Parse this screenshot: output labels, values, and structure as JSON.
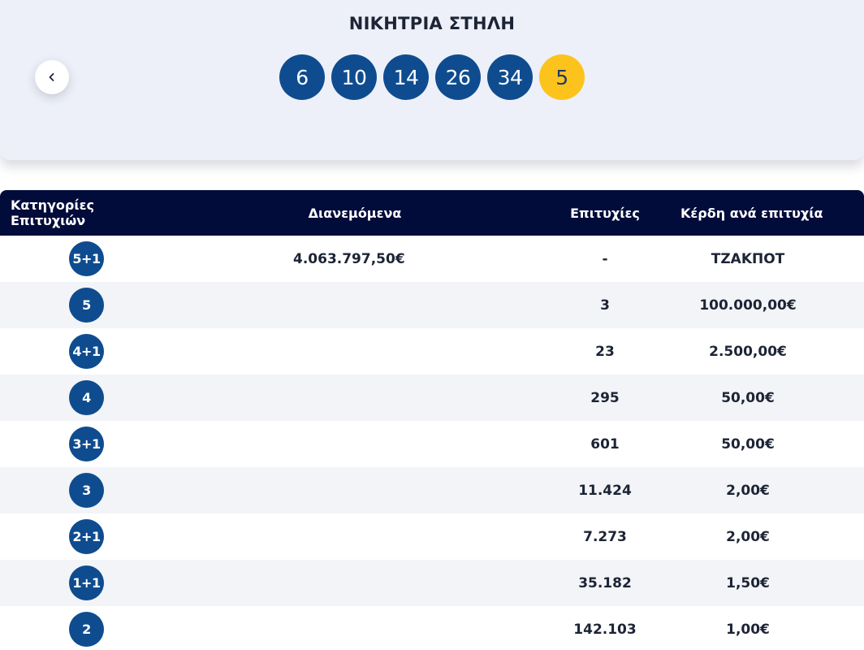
{
  "draw": {
    "title": "ΝΙΚΗΤΡΙΑ ΣΤΗΛΗ",
    "numbers": [
      "6",
      "10",
      "14",
      "26",
      "34"
    ],
    "bonus": "5"
  },
  "table": {
    "headers": {
      "category": "Κατηγορίες Επιτυχιών",
      "distributed": "Διανεμόμενα",
      "winners": "Επιτυχίες",
      "prize": "Κέρδη ανά επιτυχία"
    },
    "rows": [
      {
        "category": "5+1",
        "distributed": "4.063.797,50€",
        "winners": "-",
        "prize": "ΤΖΑΚΠΟΤ"
      },
      {
        "category": "5",
        "distributed": "",
        "winners": "3",
        "prize": "100.000,00€"
      },
      {
        "category": "4+1",
        "distributed": "",
        "winners": "23",
        "prize": "2.500,00€"
      },
      {
        "category": "4",
        "distributed": "",
        "winners": "295",
        "prize": "50,00€"
      },
      {
        "category": "3+1",
        "distributed": "",
        "winners": "601",
        "prize": "50,00€"
      },
      {
        "category": "3",
        "distributed": "",
        "winners": "11.424",
        "prize": "2,00€"
      },
      {
        "category": "2+1",
        "distributed": "",
        "winners": "7.273",
        "prize": "2,00€"
      },
      {
        "category": "1+1",
        "distributed": "",
        "winners": "35.182",
        "prize": "1,50€"
      },
      {
        "category": "2",
        "distributed": "",
        "winners": "142.103",
        "prize": "1,00€"
      }
    ]
  },
  "icons": {
    "back": "chevron-left-icon"
  },
  "colors": {
    "ball": "#0f4c8f",
    "bonus_ball": "#fcc31d",
    "header_bg": "#020c3b",
    "card_bg": "#edf0f8"
  }
}
